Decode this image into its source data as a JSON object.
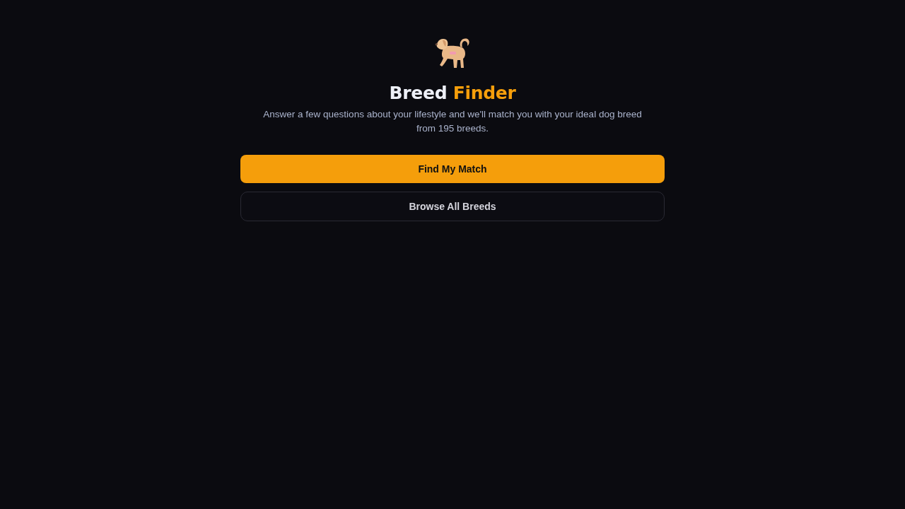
{
  "hero": {
    "title": {
      "lead": "Breed",
      "accent": "Finder"
    },
    "subtitle": "Answer a few questions about your lifestyle and we'll match you with your ideal dog breed from 195 breeds."
  },
  "actions": [
    {
      "label": "Find My Match",
      "kind": "primary"
    },
    {
      "label": "Browse All Breeds",
      "kind": "secondary"
    }
  ]
}
